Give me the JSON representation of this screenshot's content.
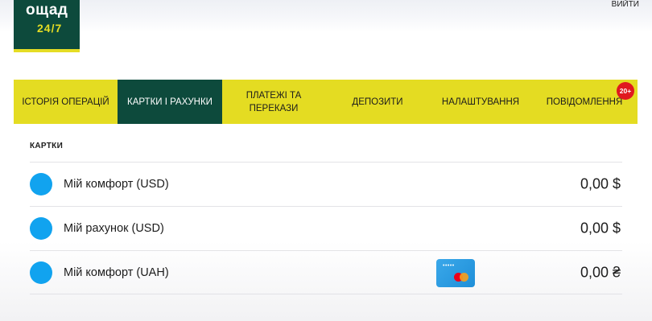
{
  "brand": {
    "name": "ощад",
    "subtitle": "24/7"
  },
  "header": {
    "logout_label": "ВИЙТИ"
  },
  "nav": {
    "items": [
      {
        "label": "ІСТОРІЯ ОПЕРАЦІЙ"
      },
      {
        "label": "КАРТКИ І РАХУНКИ"
      },
      {
        "label": "ПЛАТЕЖІ ТА ПЕРЕКАЗИ"
      },
      {
        "label": "ДЕПОЗИТИ"
      },
      {
        "label": "НАЛАШТУВАННЯ"
      },
      {
        "label": "ПОВІДОМЛЕННЯ",
        "badge": "20+"
      }
    ]
  },
  "cards_section": {
    "title": "КАРТКИ",
    "accounts": [
      {
        "name": "Мій комфорт (USD)",
        "amount": "0,00 $"
      },
      {
        "name": "Мій рахунок (USD)",
        "amount": "0,00 $"
      },
      {
        "name": "Мій комфорт (UAH)",
        "amount": "0,00 ₴",
        "card_number_mask": "•••••"
      }
    ]
  },
  "colors": {
    "brand_green": "#0d4a3c",
    "brand_yellow": "#e4dc22",
    "account_dot": "#11a3ef",
    "badge_red": "#e0191f"
  }
}
